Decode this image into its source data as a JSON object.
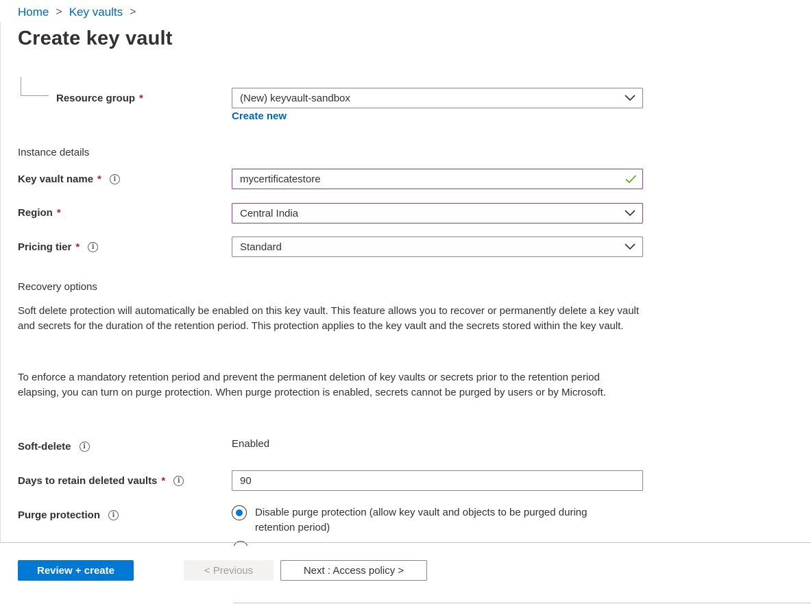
{
  "breadcrumb": {
    "home": "Home",
    "key_vaults": "Key vaults",
    "separator": ">"
  },
  "page_title": "Create key vault",
  "resource_group": {
    "label": "Resource group",
    "required_mark": "*",
    "value": "(New) keyvault-sandbox",
    "create_new": "Create new"
  },
  "instance_details": {
    "heading": "Instance details",
    "key_vault_name": {
      "label": "Key vault name",
      "required_mark": "*",
      "info_icon": "i",
      "value": "mycertificatestore"
    },
    "region": {
      "label": "Region",
      "required_mark": "*",
      "value": "Central India"
    },
    "pricing_tier": {
      "label": "Pricing tier",
      "required_mark": "*",
      "info_icon": "i",
      "value": "Standard"
    }
  },
  "recovery": {
    "heading": "Recovery options",
    "paragraph1": "Soft delete protection will automatically be enabled on this key vault. This feature allows you to recover or permanently delete a key vault and secrets for the duration of the retention period. This protection applies to the key vault and the secrets stored within the key vault.",
    "paragraph2": "To enforce a mandatory retention period and prevent the permanent deletion of key vaults or secrets prior to the retention period elapsing, you can turn on purge protection. When purge protection is enabled, secrets cannot be purged by users or by Microsoft.",
    "soft_delete": {
      "label": "Soft-delete",
      "info_icon": "i",
      "value": "Enabled"
    },
    "days_retain": {
      "label": "Days to retain deleted vaults",
      "required_mark": "*",
      "info_icon": "i",
      "value": "90"
    },
    "purge_protection": {
      "label": "Purge protection",
      "info_icon": "i",
      "option_disable": "Disable purge protection (allow key vault and objects to be purged during retention period)"
    }
  },
  "footer": {
    "review_create": "Review + create",
    "previous": "< Previous",
    "next": "Next : Access policy >"
  },
  "colors": {
    "accent": "#0078d4",
    "link": "#0067b8",
    "required": "#a4262c",
    "focus_border": "#8a3cb0",
    "valid_check": "#57a300"
  },
  "icons": {
    "dropdown": "chevron-down-icon",
    "valid": "checkmark-icon",
    "info": "info-icon"
  }
}
